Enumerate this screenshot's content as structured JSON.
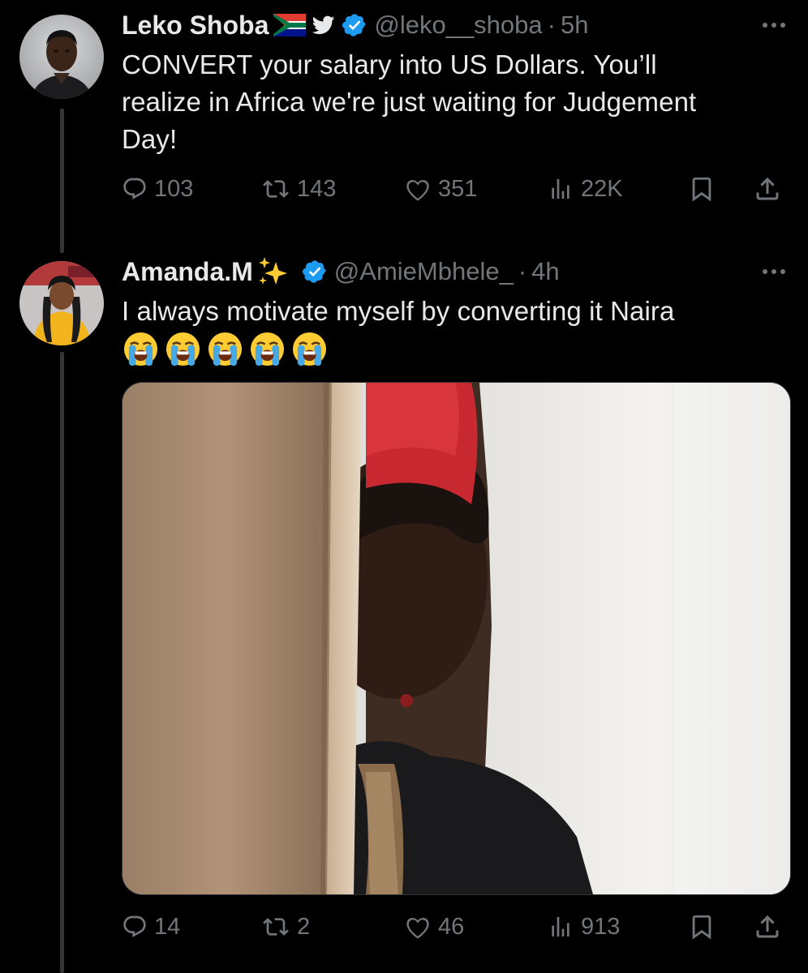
{
  "tweet_main": {
    "display_name": "Leko Shoba",
    "handle": "@leko__shoba",
    "time": "5h",
    "text_lines": [
      "CONVERT your salary into US Dollars. You’ll",
      "realize in Africa we're just waiting for Judgement",
      "Day!"
    ],
    "icons": [
      "south-africa-flag-icon",
      "bird-icon",
      "verified-badge-icon"
    ],
    "stats": {
      "replies": "103",
      "retweets": "143",
      "likes": "351",
      "views": "22K"
    }
  },
  "tweet_reply": {
    "display_name": "Amanda.M",
    "handle": "@AmieMbhele_",
    "time": "4h",
    "text": "I always motivate myself by converting it Naira",
    "emoji": [
      "😭",
      "😭",
      "😭",
      "😭",
      "😭"
    ],
    "icons": [
      "sparkles-icon",
      "verified-badge-icon"
    ],
    "stats": {
      "replies": "14",
      "retweets": "2",
      "likes": "46",
      "views": "913"
    }
  },
  "separator_dot": "·",
  "colors": {
    "background": "#000000",
    "text_primary": "#e7e9ea",
    "text_secondary": "#71767b",
    "verified": "#1d9bf0",
    "thread_line": "#333639"
  }
}
